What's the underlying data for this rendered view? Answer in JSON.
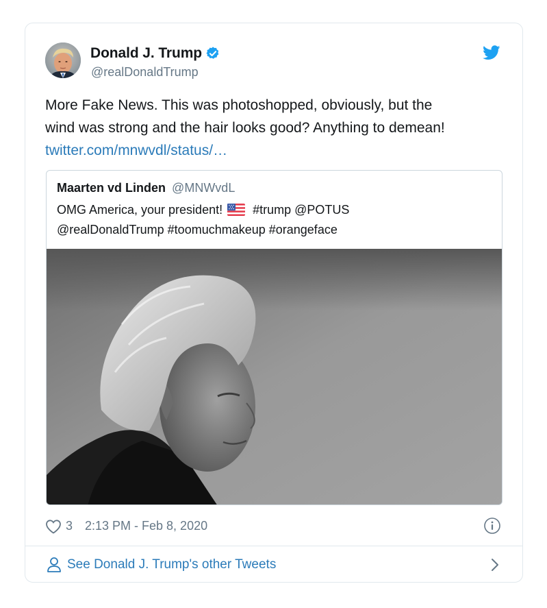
{
  "author": {
    "display_name": "Donald J. Trump",
    "handle": "@realDonaldTrump",
    "verified_icon": "verified-badge-icon",
    "avatar_icon": "avatar"
  },
  "tweet": {
    "text_line1": "More Fake News. This was photoshopped, obviously, but the",
    "text_line2": "wind was strong and the hair looks good? Anything to demean!",
    "link": "twitter.com/mnwvdl/status/…"
  },
  "quoted": {
    "name": "Maarten vd Linden",
    "handle": "@MNWvdL",
    "text_part1": "OMG America, your president!",
    "text_part2": "#trump @POTUS",
    "text_line2": "@realDonaldTrump #toomuchmakeup #orangeface",
    "flag_icon": "us-flag-icon"
  },
  "meta": {
    "likes": "3",
    "timestamp": "2:13 PM - Feb 8, 2020"
  },
  "footer": {
    "label": "See Donald J. Trump's other Tweets"
  },
  "colors": {
    "brand": "#1da1f2",
    "link": "#2b7bb9",
    "secondary_text": "#657786",
    "border": "#e1e8ed"
  }
}
